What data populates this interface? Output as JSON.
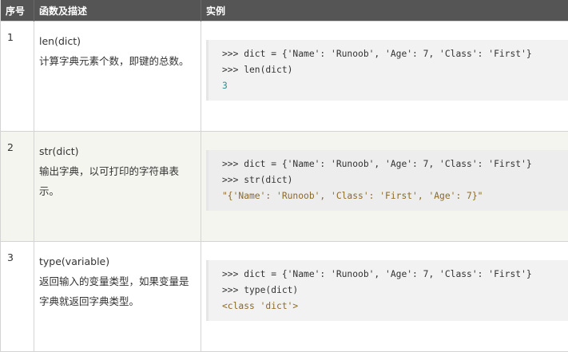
{
  "header": {
    "col_num": "序号",
    "col_desc": "函数及描述",
    "col_example": "实例"
  },
  "rows": [
    {
      "num": "1",
      "func": "len(dict)",
      "desc": "计算字典元素个数，即键的总数。",
      "code": [
        ">>> dict = {'Name': 'Runoob', 'Age': 7, 'Class': 'First'}",
        ">>> len(dict)"
      ],
      "output": "3"
    },
    {
      "num": "2",
      "func": "str(dict)",
      "desc": "输出字典，以可打印的字符串表示。",
      "code": [
        ">>> dict = {'Name': 'Runoob', 'Age': 7, 'Class': 'First'}",
        ">>> str(dict)"
      ],
      "output": "\"{'Name': 'Runoob', 'Class': 'First', 'Age': 7}\""
    },
    {
      "num": "3",
      "func": "type(variable)",
      "desc": "返回输入的变量类型，如果变量是字典就返回字典类型。",
      "code": [
        ">>> dict = {'Name': 'Runoob', 'Age': 7, 'Class': 'First'}",
        ">>> type(dict)"
      ],
      "output": "<class 'dict'>"
    }
  ]
}
